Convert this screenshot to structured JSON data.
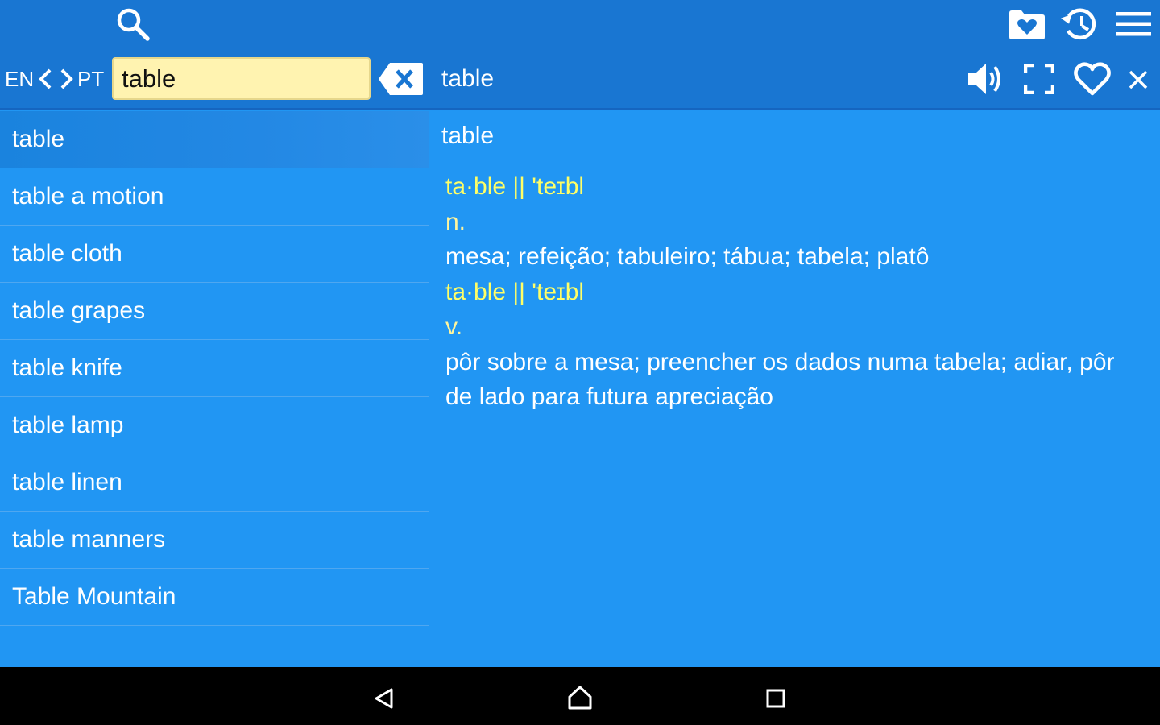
{
  "toolbar": {
    "search_icon": "search-icon",
    "favorites_folder_icon": "favorites-folder-icon",
    "history_icon": "history-icon",
    "menu_icon": "menu-icon"
  },
  "language": {
    "source": "EN",
    "target": "PT"
  },
  "search": {
    "value": "table",
    "clear_icon": "clear-icon"
  },
  "header": {
    "word": "table",
    "speaker_icon": "speaker-icon",
    "fullscreen_icon": "fullscreen-icon",
    "favorite_icon": "heart-icon",
    "close_icon": "close-icon"
  },
  "word_list": [
    "table",
    "table a motion",
    "table cloth",
    "table grapes",
    "table knife",
    "table lamp",
    "table linen",
    "table manners",
    "Table Mountain"
  ],
  "definition": {
    "title": "table",
    "entries": [
      {
        "pronunciation": "ta·ble || 'teɪbl",
        "part_of_speech": "n.",
        "translation": "mesa; refeição; tabuleiro; tábua; tabela; platô"
      },
      {
        "pronunciation": "ta·ble || 'teɪbl",
        "part_of_speech": "v.",
        "translation": "pôr sobre a mesa; preencher os dados numa tabela; adiar, pôr de lado para futura apreciação"
      }
    ]
  },
  "navbar": {
    "back_icon": "back-icon",
    "home_icon": "home-icon",
    "recents_icon": "recents-icon"
  },
  "colors": {
    "toolbar": "#1976d2",
    "background": "#2196f3",
    "search_field": "#fff3b0",
    "pronunciation": "#ffff66",
    "navbar": "#000000"
  }
}
